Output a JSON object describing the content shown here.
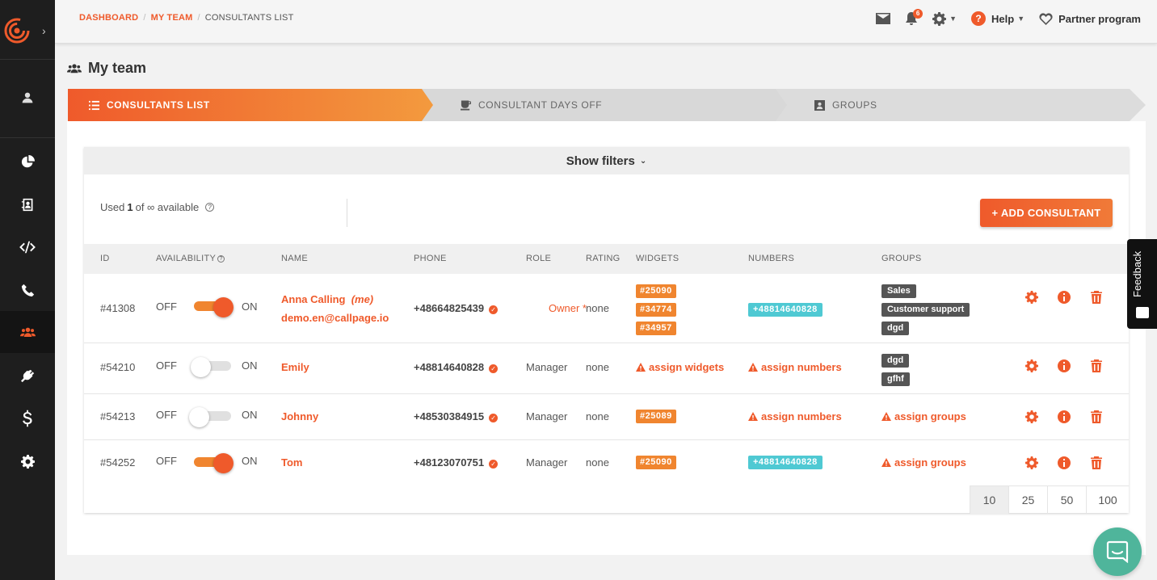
{
  "breadcrumb": {
    "dashboard": "DASHBOARD",
    "my_team": "MY TEAM",
    "current": "CONSULTANTS LIST"
  },
  "topbar": {
    "notifications_count": "6",
    "help": "Help",
    "partner": "Partner program"
  },
  "page": {
    "title": "My team"
  },
  "tabs": [
    {
      "label": "CONSULTANTS LIST"
    },
    {
      "label": "CONSULTANT DAYS OFF"
    },
    {
      "label": "GROUPS"
    }
  ],
  "filters": {
    "label": "Show filters"
  },
  "usage": {
    "prefix": "Used",
    "count": "1",
    "middle": "of ∞ available"
  },
  "add_button": "+ ADD CONSULTANT",
  "table": {
    "headers": [
      "ID",
      "AVAILABILITY",
      "NAME",
      "PHONE",
      "ROLE",
      "RATING",
      "WIDGETS",
      "NUMBERS",
      "GROUPS"
    ],
    "off_label": "OFF",
    "on_label": "ON",
    "rows": [
      {
        "id": "#41308",
        "available": true,
        "name": "Anna Calling",
        "name_suffix": "(me)",
        "email": "demo.en@callpage.io",
        "phone": "+48664825439",
        "role": "Owner *",
        "rating": "none",
        "widgets": [
          "#25090",
          "#34774",
          "#34957"
        ],
        "numbers": [
          "+48814640828"
        ],
        "groups": [
          "Sales",
          "Customer support",
          "dgd"
        ]
      },
      {
        "id": "#54210",
        "available": false,
        "name": "Emily",
        "phone": "+48814640828",
        "role": "Manager",
        "rating": "none",
        "widgets_warning": "assign widgets",
        "numbers_warning": "assign numbers",
        "groups": [
          "dgd",
          "gfhf"
        ]
      },
      {
        "id": "#54213",
        "available": false,
        "name": "Johnny",
        "phone": "+48530384915",
        "role": "Manager",
        "rating": "none",
        "widgets": [
          "#25089"
        ],
        "numbers_warning": "assign numbers",
        "groups_warning": "assign groups"
      },
      {
        "id": "#54252",
        "available": true,
        "name": "Tom",
        "phone": "+48123070751",
        "role": "Manager",
        "rating": "none",
        "widgets": [
          "#25090"
        ],
        "numbers": [
          "+48814640828"
        ],
        "groups_warning": "assign groups"
      }
    ]
  },
  "pagination": [
    "10",
    "25",
    "50",
    "100"
  ],
  "feedback": "Feedback",
  "colors": {
    "accent": "#ef5a2b",
    "widget_tag": "#f0852f",
    "number_tag": "#4fc9d3",
    "group_tag": "#555555",
    "sidebar": "#1e1e1e"
  }
}
